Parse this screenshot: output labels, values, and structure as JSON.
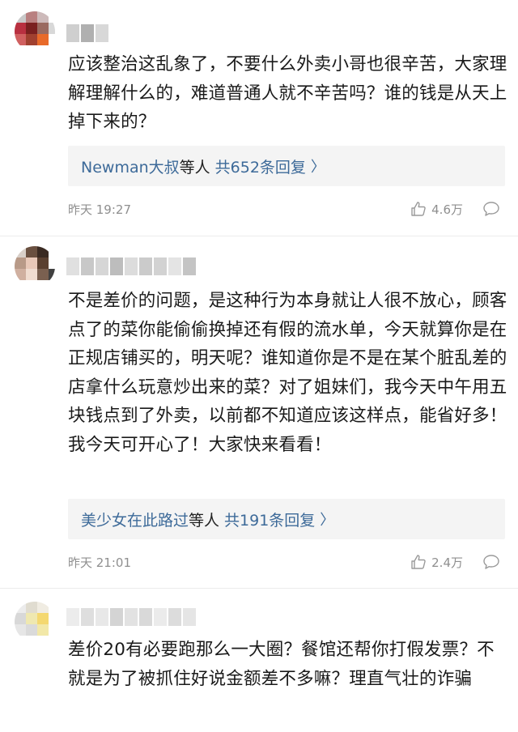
{
  "comments": [
    {
      "body": "应该整治这乱象了，不要什么外卖小哥也很辛苦，大家理解理解什么的，难道普通人就不辛苦吗？谁的钱是从天上掉下来的？",
      "reply_names": "Newman大叔",
      "reply_deng": "等人",
      "reply_count": "共652条回复",
      "reply_chev": "〉",
      "time": "昨天 19:27",
      "likes": "4.6万"
    },
    {
      "body": "不是差价的问题，是这种行为本身就让人很不放心，顾客点了的菜你能偷偷换掉还有假的流水单，今天就算你是在正规店铺买的，明天呢？谁知道你是不是在某个脏乱差的店拿什么玩意炒出来的菜？对了姐妹们，我今天中午用五块钱点到了外卖，以前都不知道应该这样点，能省好多！我今天可开心了！大家快来看看！",
      "reply_names": "美少女在此路过",
      "reply_deng": "等人",
      "reply_count": "共191条回复",
      "reply_chev": "〉",
      "time": "昨天 21:01",
      "likes": "2.4万"
    },
    {
      "body": "差价20有必要跑那么一大圈？餐馆还帮你打假发票？不就是为了被抓住好说金额差不多嘛？理直气壮的诈骗"
    }
  ],
  "icons": {
    "like": "thumbs-up-icon",
    "reply": "speech-bubble-icon"
  },
  "colors": {
    "link": "#3d6a99",
    "meta": "#8f8f8f",
    "reply_bg": "#f4f4f4"
  }
}
